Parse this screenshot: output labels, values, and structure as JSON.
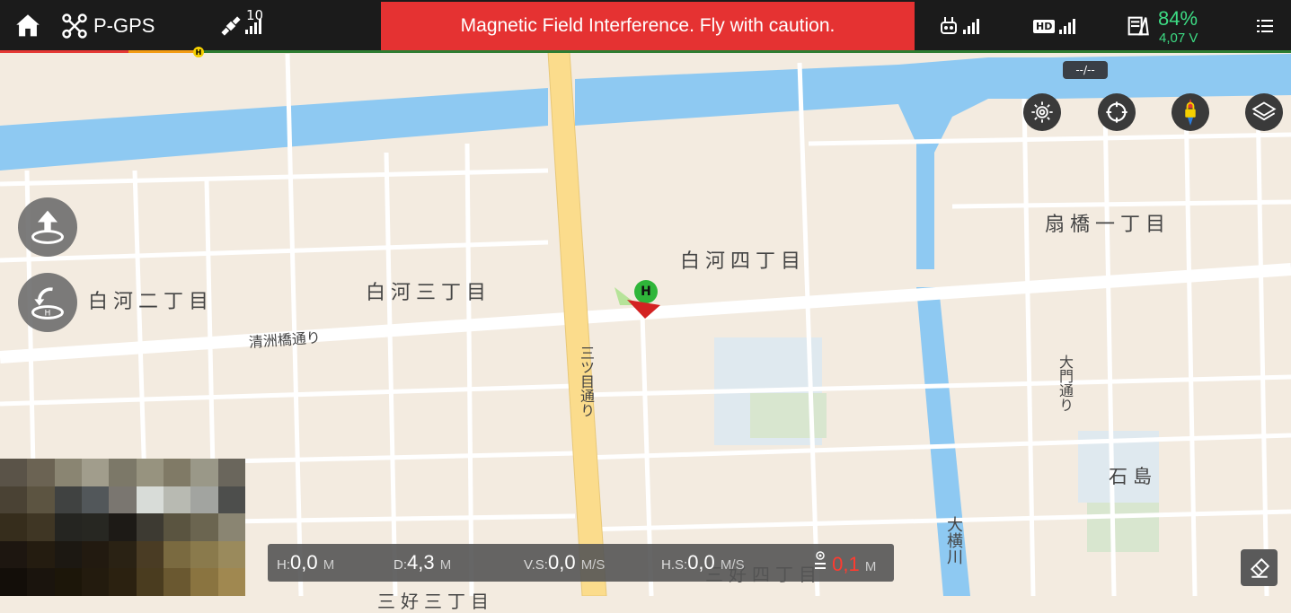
{
  "topbar": {
    "flight_mode": "P-GPS",
    "satellite_count": "10",
    "warning": "Magnetic Field Interference. Fly with caution.",
    "hd_label": "HD",
    "battery_percent": "84%",
    "battery_voltage": "4,07 V",
    "distance_badge": "--/--"
  },
  "map_labels": {
    "shirakawa2": "白河二丁目",
    "shirakawa3": "白河三丁目",
    "shirakawa4": "白河四丁目",
    "ogibashi1": "扇橋一丁目",
    "kiyosubashi": "清洲橋通り",
    "mitsume": "三ツ目通り",
    "daimon": "大門通り",
    "ishijima": "石島",
    "ooyokogawa": "大横川",
    "miyoshi4": "三好四丁目",
    "miyoshi3": "三好三丁目",
    "home_marker": "H"
  },
  "telemetry": {
    "h_label": "H:",
    "h_value": "0,0",
    "h_unit": "M",
    "d_label": "D:",
    "d_value": "4,3",
    "d_unit": "M",
    "vs_label": "V.S:",
    "vs_value": "0,0",
    "vs_unit": "M/S",
    "hs_label": "H.S:",
    "hs_value": "0,0",
    "hs_unit": "M/S",
    "alt_value": "0,1",
    "alt_unit": "M"
  },
  "colors": {
    "warning_bg": "#e53232",
    "battery": "#3ddc84",
    "water": "#8ec9f2",
    "road_main": "#fbdc8c",
    "map_bg": "#f3ebe0",
    "aircraft": "#d32222",
    "home": "#2fb53a"
  },
  "icons": [
    "home-icon",
    "drone-icon",
    "satellite-icon",
    "remote-controller-icon",
    "hd-video-icon",
    "battery-icon",
    "menu-icon",
    "camera-settings-icon",
    "recenter-icon",
    "compass-lock-icon",
    "map-layers-icon",
    "takeoff-icon",
    "return-home-icon",
    "eraser-icon"
  ]
}
